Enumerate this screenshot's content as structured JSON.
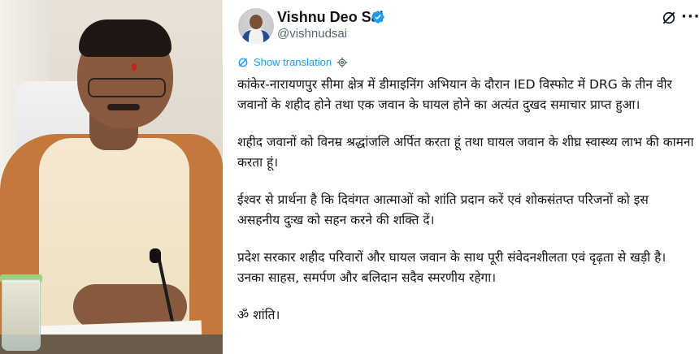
{
  "tweet": {
    "author_name": "Vishnu Deo Sai",
    "handle": "@vishnudsai",
    "show_translation": "Show translation",
    "paragraphs": [
      "कांकेर-नारायणपुर सीमा क्षेत्र में डीमाइनिंग अभियान के दौरान IED विस्फोट में DRG के तीन वीर जवानों के शहीद होने तथा एक जवान के घायल होने का अत्यंत दुखद समाचार प्राप्त हुआ।",
      "शहीद जवानों को विनम्र श्रद्धांजलि अर्पित करता हूं तथा घायल जवान के शीघ्र स्वास्थ्य लाभ की कामना करता हूं।",
      "ईश्वर से प्रार्थना है कि दिवंगत आत्माओं को शांति प्रदान करें एवं शोकसंतप्त परिजनों को इस असहनीय दुःख को सहन करने की शक्ति दें।",
      "प्रदेश सरकार शहीद परिवारों और घायल जवान के साथ पूरी संवेदनशीलता एवं दृढ़ता से खड़ी है। उनका साहस, समर्पण और बलिदान सदैव स्मरणीय रहेगा।",
      "ॐ शांति।"
    ]
  },
  "icons": {
    "verified": "verified-badge-icon",
    "grok": "grok-icon",
    "more": "more-options-icon",
    "translate": "translate-icon",
    "settings": "gear-icon"
  },
  "colors": {
    "link_blue": "#1d9bf0",
    "handle_gray": "#536471",
    "text": "#0f1419"
  }
}
